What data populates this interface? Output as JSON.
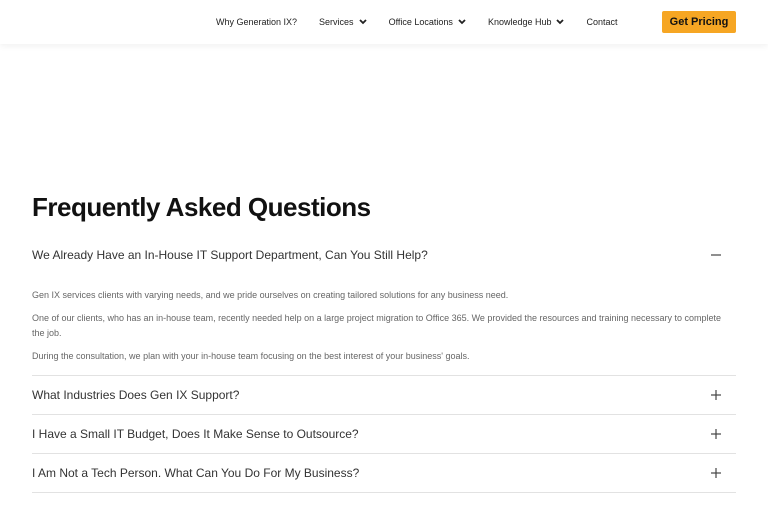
{
  "nav": {
    "items": [
      {
        "label": "Why Generation IX?",
        "dropdown": false
      },
      {
        "label": "Services",
        "dropdown": true
      },
      {
        "label": "Office Locations",
        "dropdown": true
      },
      {
        "label": "Knowledge Hub",
        "dropdown": true
      },
      {
        "label": "Contact",
        "dropdown": false
      }
    ],
    "cta_label": "Get Pricing",
    "cta_color": "#f6a623"
  },
  "faq": {
    "title": "Frequently Asked Questions",
    "expanded": {
      "question": "We Already Have an In-House IT Support Department, Can You Still Help?",
      "toggle_icon": "minus-icon",
      "answer": [
        "Gen IX services clients with varying needs, and we pride ourselves on creating tailored solutions for any business need.",
        "One of our clients, who has an in-house team, recently needed help on a large project migration to Office 365. We provided the resources and training necessary to complete the job.",
        "During the consultation, we plan with your in-house team focusing on the best interest of your business' goals."
      ]
    },
    "collapsed": [
      {
        "question": "What Industries Does Gen IX Support?",
        "toggle_icon": "plus-icon"
      },
      {
        "question": "I Have a Small IT Budget, Does It Make Sense to Outsource?",
        "toggle_icon": "plus-icon"
      },
      {
        "question": "I Am Not a Tech Person. What Can You Do For My Business?",
        "toggle_icon": "plus-icon"
      }
    ]
  }
}
